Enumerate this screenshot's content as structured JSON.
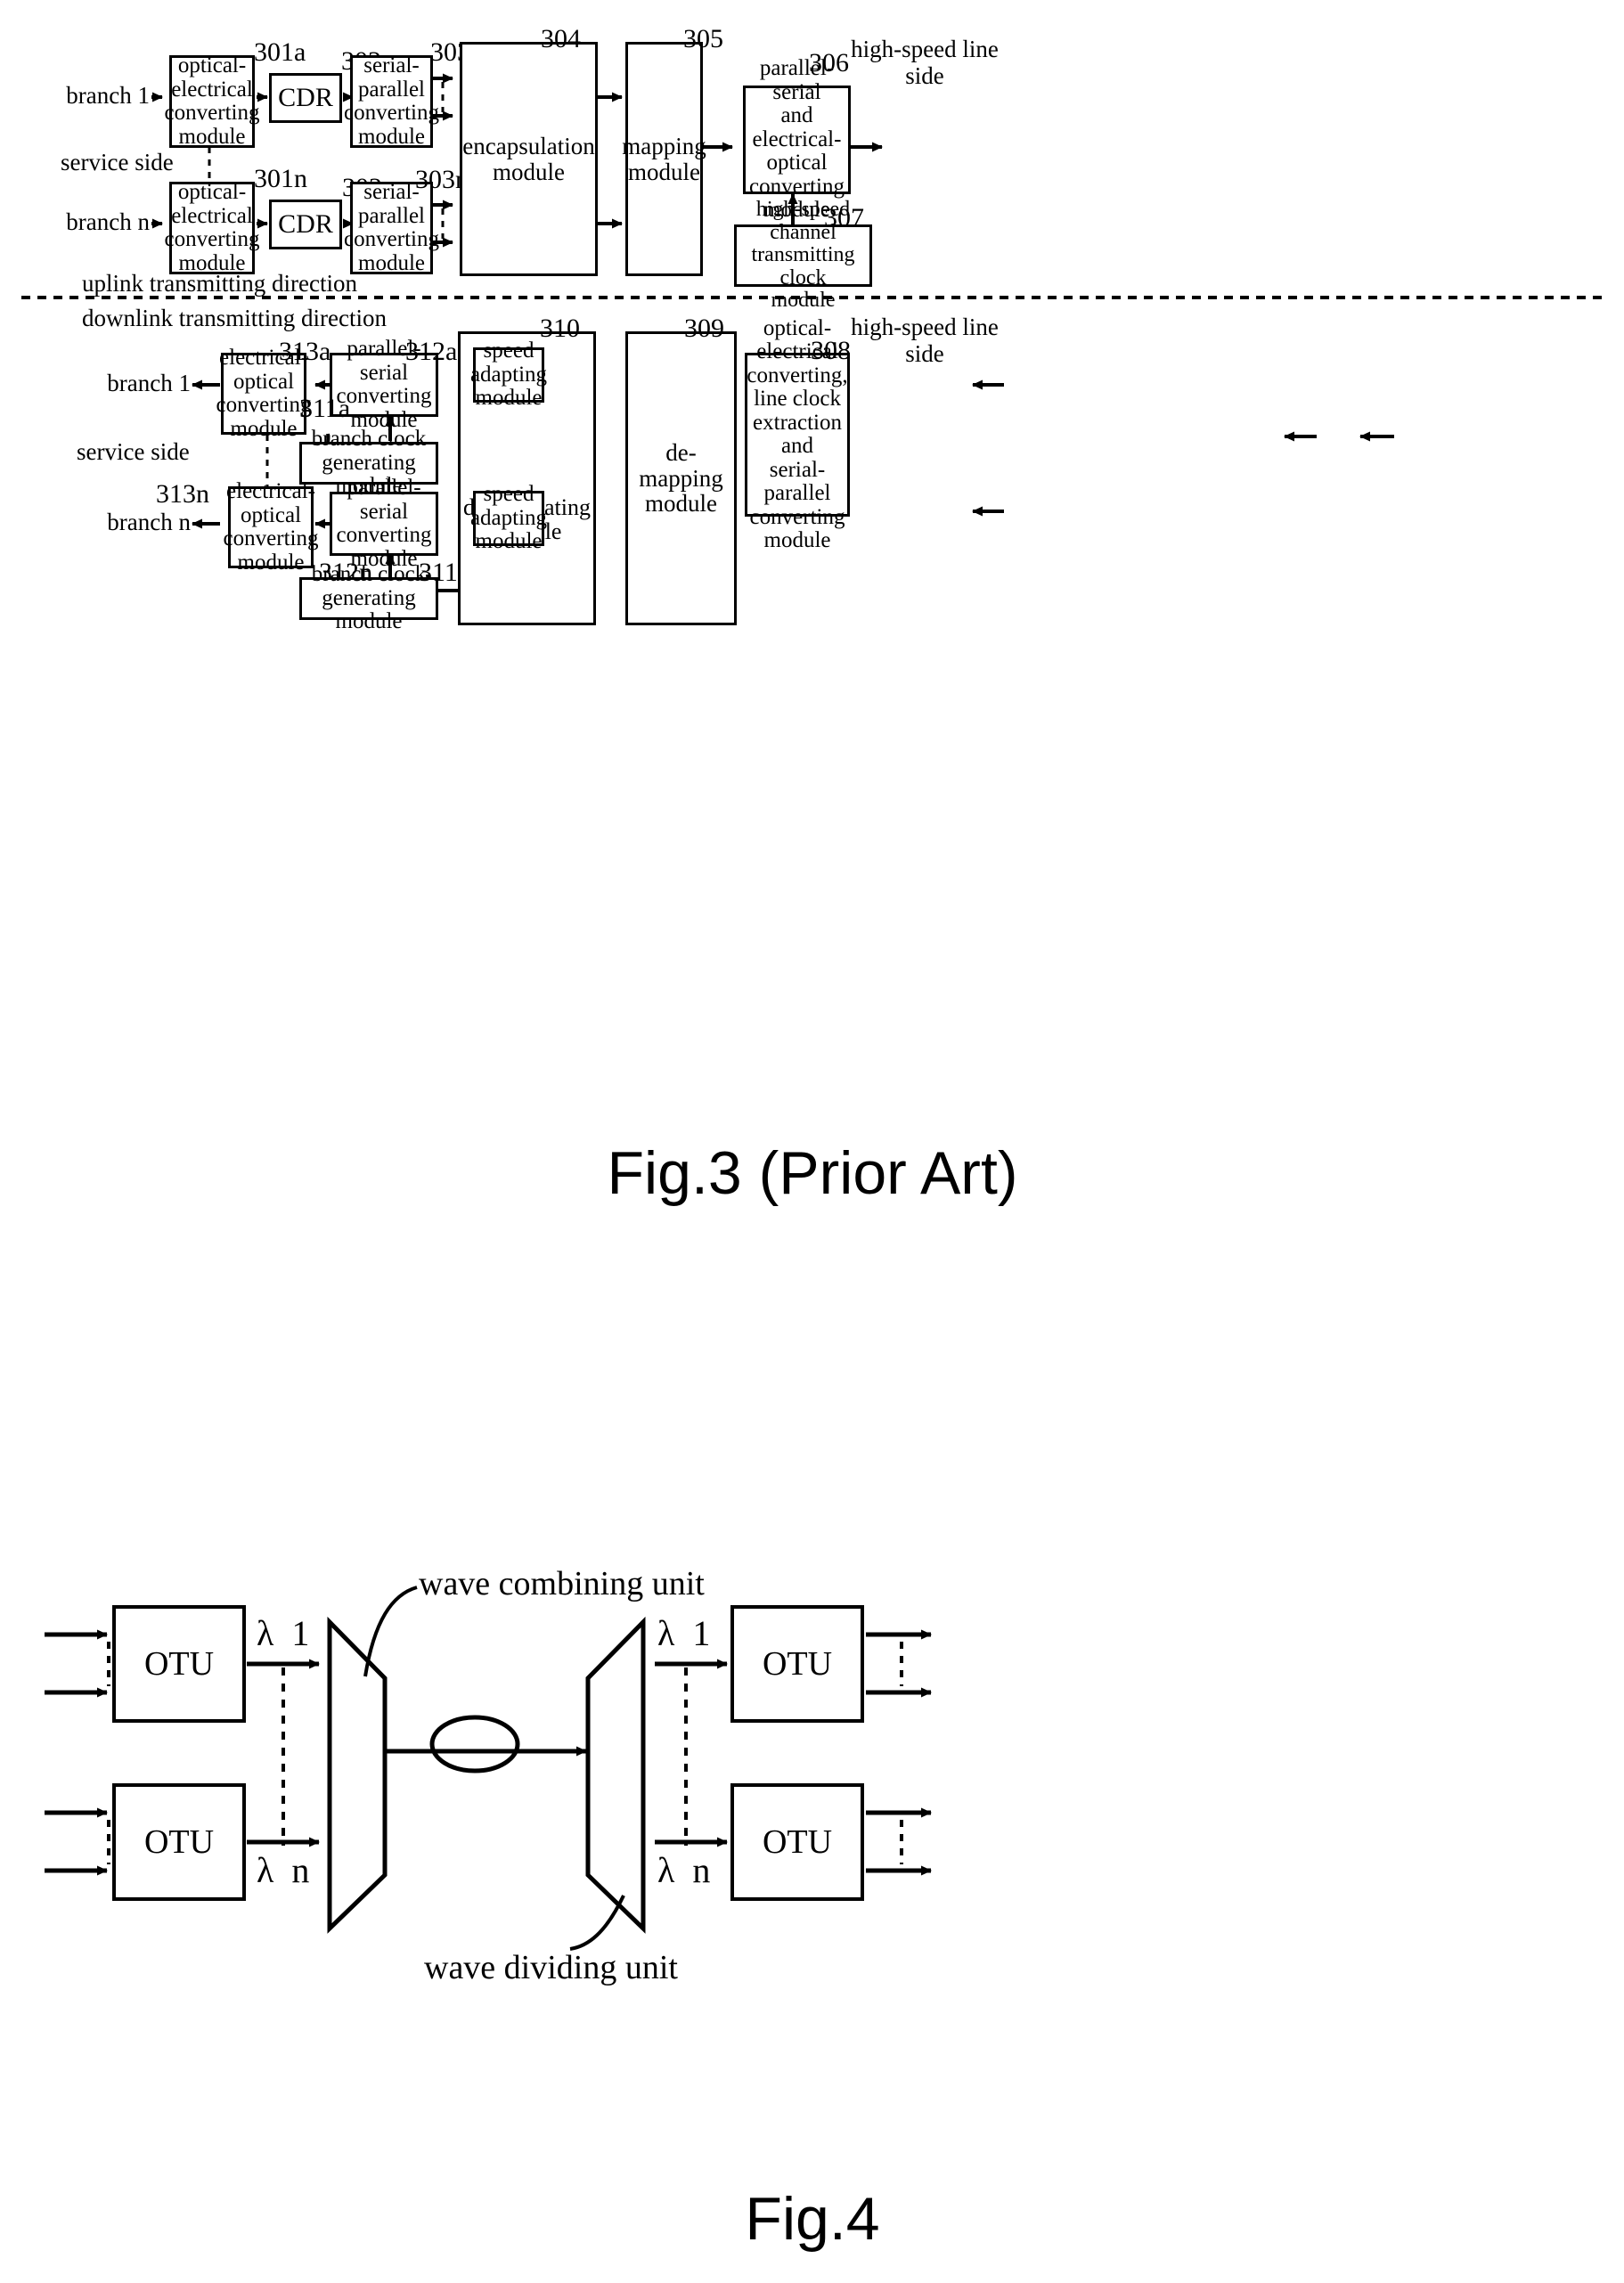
{
  "figures": [
    {
      "id": "fig3",
      "caption": "Fig.3 (Prior Art)",
      "divider_labels": {
        "uplink": "uplink transmitting direction",
        "downlink": "downlink transmitting direction"
      },
      "side_labels": {
        "service_side_top": "service side",
        "service_side_bottom": "service side",
        "high_speed_line_top": "high-speed line\nside",
        "high_speed_line_bottom": "high-speed line\nside"
      },
      "branch_labels": {
        "in_1": "branch 1",
        "in_n": "branch n",
        "out_1": "branch 1",
        "out_n": "branch n"
      },
      "uplink_blocks": [
        {
          "ref": "301a",
          "text": "optical-\nelectrical\nconverting\nmodule"
        },
        {
          "ref": "302a",
          "text": "CDR"
        },
        {
          "ref": "303a",
          "text": "serial-\nparallel\nconverting\nmodule"
        },
        {
          "ref": "301n",
          "text": "optical-\nelectrical\nconverting\nmodule"
        },
        {
          "ref": "302",
          "text": "CDR"
        },
        {
          "ref": "303n",
          "text": "serial-\nparallel\nconverting\nmodule"
        },
        {
          "ref": "304",
          "text": "encapsulation\nmodule"
        },
        {
          "ref": "305",
          "text": "mapping\nmodule"
        },
        {
          "ref": "306",
          "text": "parallel-serial\nand electrical-\noptical\nconverting\nmodule"
        },
        {
          "ref": "307",
          "text": "high-speed channel\ntransmitting clock\nmodule"
        }
      ],
      "downlink_blocks": [
        {
          "ref": "313a",
          "text": "electrical-\noptical\nconverting\nmodule"
        },
        {
          "ref": "312a",
          "text": "parallel-serial\nconverting\nmodule"
        },
        {
          "ref": "311a",
          "text": "branch clock\ngenerating module"
        },
        {
          "ref": "313n",
          "text": "electrical-\noptical\nconverting\nmodule"
        },
        {
          "ref": "312n",
          "text": "parallel-serial\nconverting\nmodule"
        },
        {
          "ref": "311n",
          "text": "branch clock\ngenerating module"
        },
        {
          "ref": "310",
          "text": "decapsulating\nmodule"
        },
        {
          "ref": "",
          "text": "speed\nadapting\nmodule"
        },
        {
          "ref": "",
          "text": "speed\nadapting\nmodule"
        },
        {
          "ref": "309",
          "text": "de-mapping\nmodule"
        },
        {
          "ref": "308",
          "text": "optical-\nelectrical\nconverting,\nline clock\nextraction and\nserial-parallel\nconverting\nmodule"
        }
      ]
    },
    {
      "id": "fig4",
      "caption": "Fig.4",
      "annotations": {
        "wave_combining": "wave combining unit",
        "wave_dividing": "wave dividing unit"
      },
      "blocks": [
        {
          "id": "otu-tx-1",
          "text": "OTU"
        },
        {
          "id": "otu-tx-n",
          "text": "OTU"
        },
        {
          "id": "otu-rx-1",
          "text": "OTU"
        },
        {
          "id": "otu-rx-n",
          "text": "OTU"
        }
      ],
      "lambda_labels": {
        "tx_1": "λ  1",
        "tx_n": "λ  n",
        "rx_1": "λ  1",
        "rx_n": "λ  n"
      }
    }
  ]
}
